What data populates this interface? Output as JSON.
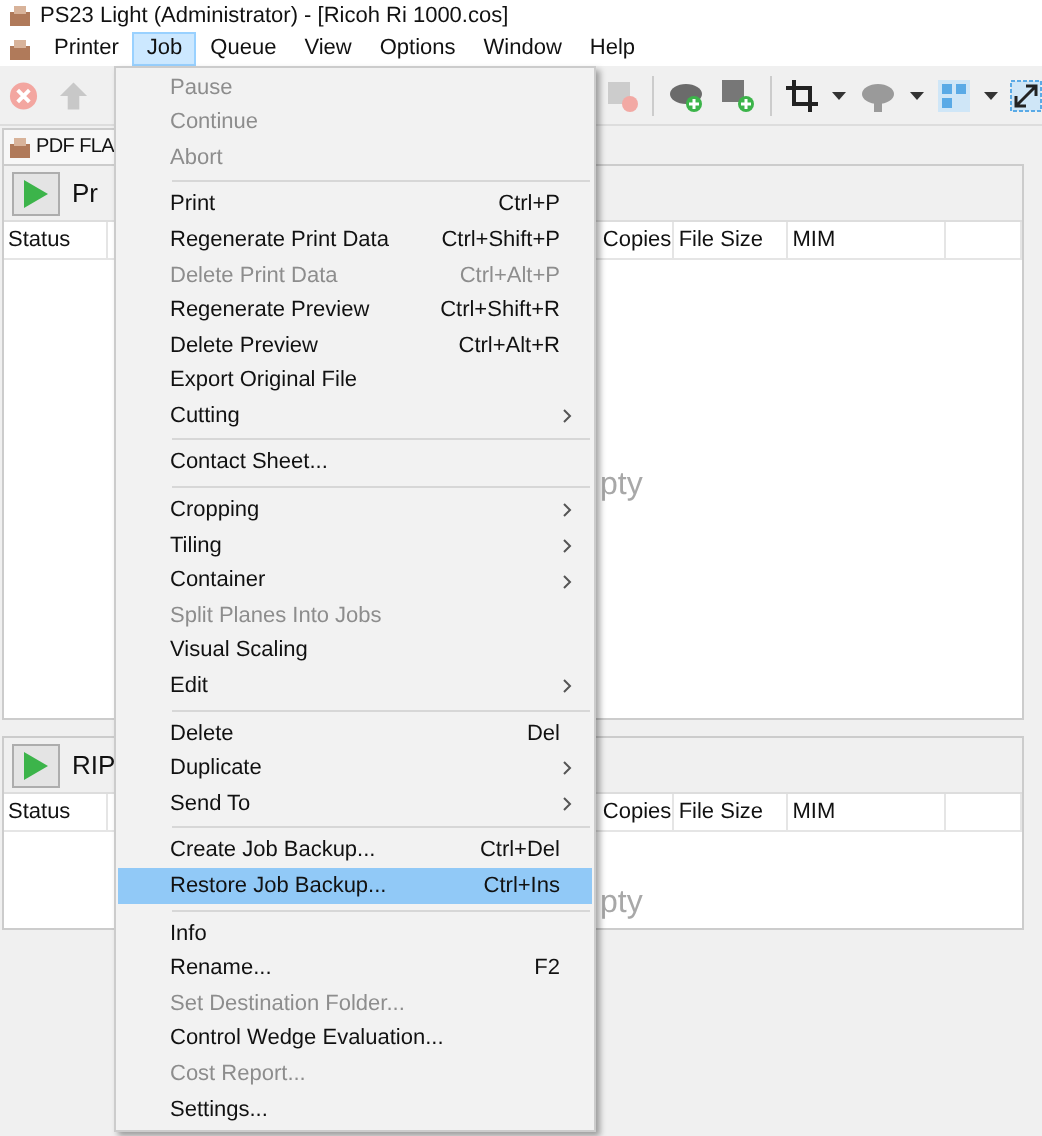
{
  "window": {
    "title": "PS23 Light (Administrator) - [Ricoh Ri 1000.cos]"
  },
  "menubar": [
    {
      "label": "Printer",
      "selected": false
    },
    {
      "label": "Job",
      "selected": true
    },
    {
      "label": "Queue",
      "selected": false
    },
    {
      "label": "View",
      "selected": false
    },
    {
      "label": "Options",
      "selected": false
    },
    {
      "label": "Window",
      "selected": false
    },
    {
      "label": "Help",
      "selected": false
    }
  ],
  "tab": {
    "label": "PDF FLA"
  },
  "panels": [
    {
      "button_label": "Pr",
      "columns": [
        "Status",
        "Copies",
        "File Size",
        "MIM"
      ],
      "empty_text": "pty"
    },
    {
      "button_label": "RIP",
      "columns": [
        "Status",
        "Copies",
        "File Size",
        "MIM"
      ],
      "empty_text": "pty"
    }
  ],
  "job_menu": [
    {
      "kind": "item",
      "label": "Pause",
      "disabled": true,
      "selected": false
    },
    {
      "kind": "item",
      "label": "Continue",
      "disabled": true,
      "selected": false
    },
    {
      "kind": "item",
      "label": "Abort",
      "disabled": true,
      "selected": false
    },
    {
      "kind": "separator"
    },
    {
      "kind": "item",
      "label": "Print",
      "shortcut": "Ctrl+P",
      "disabled": false,
      "selected": false
    },
    {
      "kind": "item",
      "label": "Regenerate Print Data",
      "shortcut": "Ctrl+Shift+P",
      "disabled": false,
      "selected": false
    },
    {
      "kind": "item",
      "label": "Delete Print Data",
      "shortcut": "Ctrl+Alt+P",
      "disabled": true,
      "selected": false
    },
    {
      "kind": "item",
      "label": "Regenerate Preview",
      "shortcut": "Ctrl+Shift+R",
      "disabled": false,
      "selected": false
    },
    {
      "kind": "item",
      "label": "Delete Preview",
      "shortcut": "Ctrl+Alt+R",
      "disabled": false,
      "selected": false
    },
    {
      "kind": "item",
      "label": "Export Original File",
      "disabled": false,
      "selected": false
    },
    {
      "kind": "item",
      "label": "Cutting",
      "submenu": true,
      "disabled": false,
      "selected": false
    },
    {
      "kind": "separator"
    },
    {
      "kind": "item",
      "label": "Contact Sheet...",
      "disabled": false,
      "selected": false
    },
    {
      "kind": "separator"
    },
    {
      "kind": "item",
      "label": "Cropping",
      "submenu": true,
      "disabled": false,
      "selected": false
    },
    {
      "kind": "item",
      "label": "Tiling",
      "submenu": true,
      "disabled": false,
      "selected": false
    },
    {
      "kind": "item",
      "label": "Container",
      "submenu": true,
      "disabled": false,
      "selected": false
    },
    {
      "kind": "item",
      "label": "Split Planes Into Jobs",
      "disabled": true,
      "selected": false
    },
    {
      "kind": "item",
      "label": "Visual Scaling",
      "disabled": false,
      "selected": false
    },
    {
      "kind": "item",
      "label": "Edit",
      "submenu": true,
      "disabled": false,
      "selected": false
    },
    {
      "kind": "separator"
    },
    {
      "kind": "item",
      "label": "Delete",
      "shortcut": "Del",
      "disabled": false,
      "selected": false
    },
    {
      "kind": "item",
      "label": "Duplicate",
      "submenu": true,
      "disabled": false,
      "selected": false
    },
    {
      "kind": "item",
      "label": "Send To",
      "submenu": true,
      "disabled": false,
      "selected": false
    },
    {
      "kind": "separator"
    },
    {
      "kind": "item",
      "label": "Create Job Backup...",
      "shortcut": "Ctrl+Del",
      "disabled": false,
      "selected": false
    },
    {
      "kind": "item",
      "label": "Restore Job Backup...",
      "shortcut": "Ctrl+Ins",
      "disabled": false,
      "selected": true
    },
    {
      "kind": "separator"
    },
    {
      "kind": "item",
      "label": "Info",
      "disabled": false,
      "selected": false
    },
    {
      "kind": "item",
      "label": "Rename...",
      "shortcut": "F2",
      "disabled": false,
      "selected": false
    },
    {
      "kind": "item",
      "label": "Set Destination Folder...",
      "disabled": true,
      "selected": false
    },
    {
      "kind": "item",
      "label": "Control Wedge Evaluation...",
      "disabled": false,
      "selected": false
    },
    {
      "kind": "item",
      "label": "Cost Report...",
      "disabled": true,
      "selected": false
    },
    {
      "kind": "item",
      "label": "Settings...",
      "disabled": false,
      "selected": false
    }
  ]
}
